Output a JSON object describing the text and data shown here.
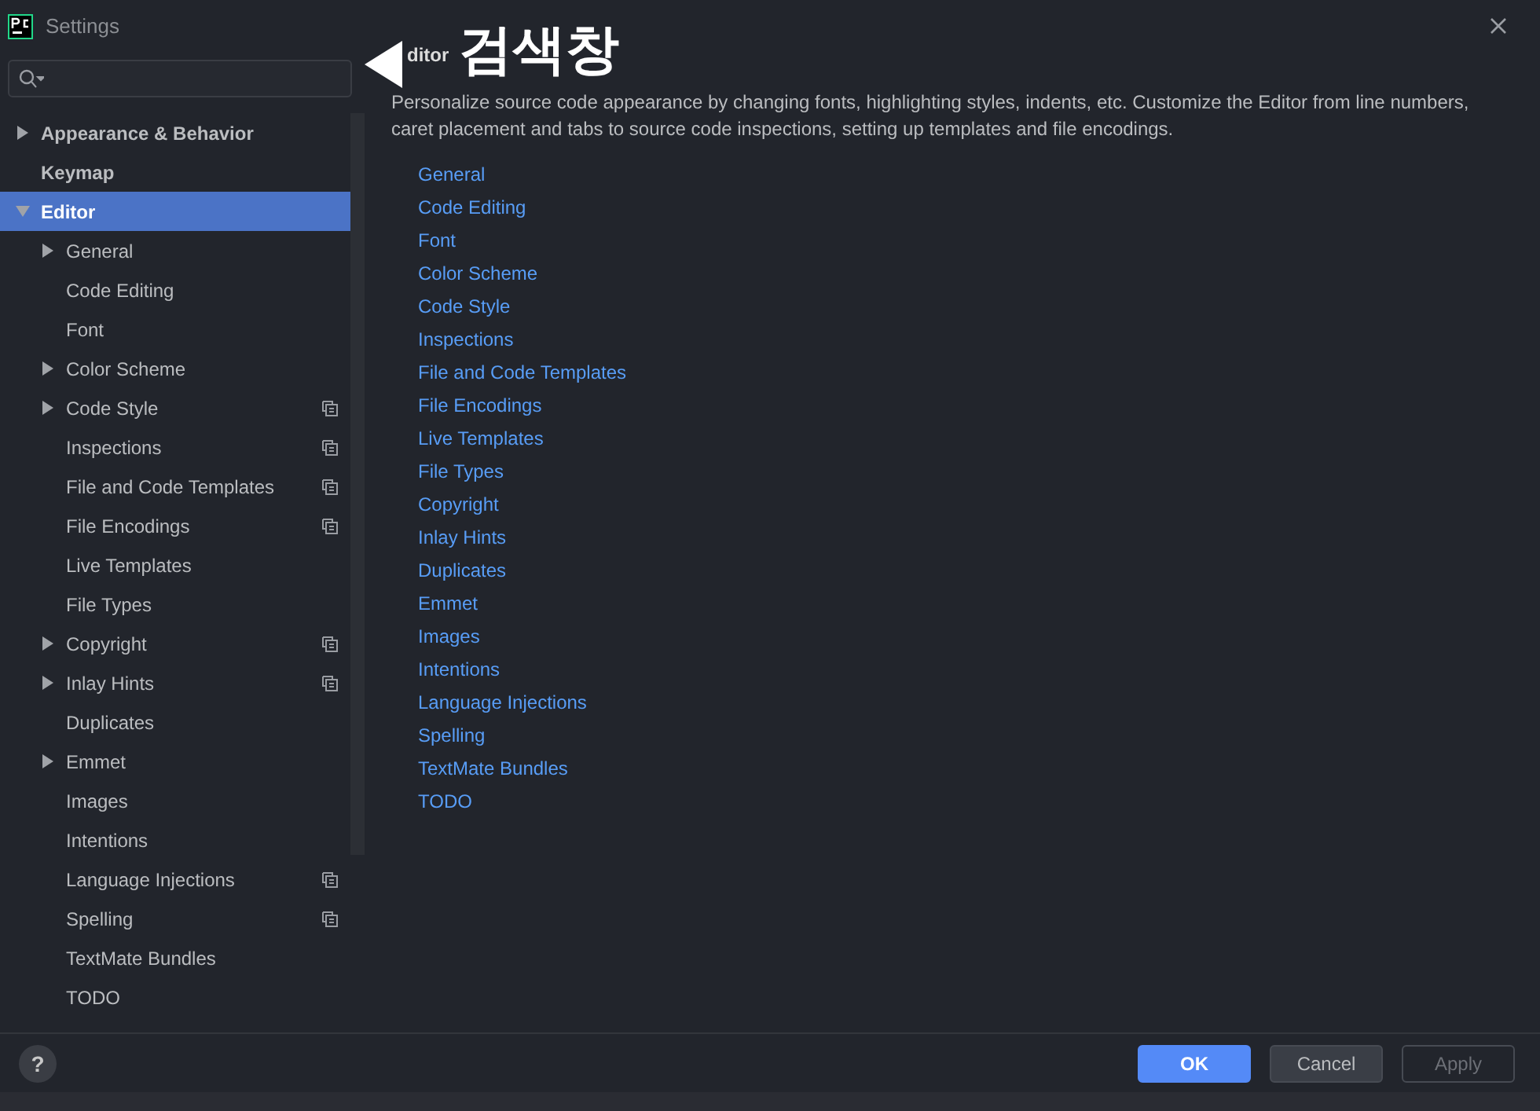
{
  "window": {
    "title": "Settings"
  },
  "annotation": {
    "text": "검색창"
  },
  "tree": [
    {
      "label": "Appearance & Behavior",
      "expandable": true,
      "expanded": false,
      "selected": false,
      "project_level": false
    },
    {
      "label": "Keymap",
      "expandable": false,
      "expanded": false,
      "selected": false,
      "project_level": false
    },
    {
      "label": "Editor",
      "expandable": true,
      "expanded": true,
      "selected": true,
      "project_level": false,
      "children": [
        {
          "label": "General",
          "expandable": true,
          "expanded": false,
          "selected": false,
          "project_level": false
        },
        {
          "label": "Code Editing",
          "expandable": false,
          "expanded": false,
          "selected": false,
          "project_level": false
        },
        {
          "label": "Font",
          "expandable": false,
          "expanded": false,
          "selected": false,
          "project_level": false
        },
        {
          "label": "Color Scheme",
          "expandable": true,
          "expanded": false,
          "selected": false,
          "project_level": false
        },
        {
          "label": "Code Style",
          "expandable": true,
          "expanded": false,
          "selected": false,
          "project_level": true
        },
        {
          "label": "Inspections",
          "expandable": false,
          "expanded": false,
          "selected": false,
          "project_level": true
        },
        {
          "label": "File and Code Templates",
          "expandable": false,
          "expanded": false,
          "selected": false,
          "project_level": true
        },
        {
          "label": "File Encodings",
          "expandable": false,
          "expanded": false,
          "selected": false,
          "project_level": true
        },
        {
          "label": "Live Templates",
          "expandable": false,
          "expanded": false,
          "selected": false,
          "project_level": false
        },
        {
          "label": "File Types",
          "expandable": false,
          "expanded": false,
          "selected": false,
          "project_level": false
        },
        {
          "label": "Copyright",
          "expandable": true,
          "expanded": false,
          "selected": false,
          "project_level": true
        },
        {
          "label": "Inlay Hints",
          "expandable": true,
          "expanded": false,
          "selected": false,
          "project_level": true
        },
        {
          "label": "Duplicates",
          "expandable": false,
          "expanded": false,
          "selected": false,
          "project_level": false
        },
        {
          "label": "Emmet",
          "expandable": true,
          "expanded": false,
          "selected": false,
          "project_level": false
        },
        {
          "label": "Images",
          "expandable": false,
          "expanded": false,
          "selected": false,
          "project_level": false
        },
        {
          "label": "Intentions",
          "expandable": false,
          "expanded": false,
          "selected": false,
          "project_level": false
        },
        {
          "label": "Language Injections",
          "expandable": false,
          "expanded": false,
          "selected": false,
          "project_level": true
        },
        {
          "label": "Spelling",
          "expandable": false,
          "expanded": false,
          "selected": false,
          "project_level": true
        },
        {
          "label": "TextMate Bundles",
          "expandable": false,
          "expanded": false,
          "selected": false,
          "project_level": false
        },
        {
          "label": "TODO",
          "expandable": false,
          "expanded": false,
          "selected": false,
          "project_level": false
        }
      ]
    }
  ],
  "content": {
    "header": "ditor",
    "description": "Personalize source code appearance by changing fonts, highlighting styles, indents, etc. Customize the Editor from line numbers, caret placement and tabs to source code inspections, setting up templates and file encodings.",
    "links": [
      "General",
      "Code Editing",
      "Font",
      "Color Scheme",
      "Code Style",
      "Inspections",
      "File and Code Templates",
      "File Encodings",
      "Live Templates",
      "File Types",
      "Copyright",
      "Inlay Hints",
      "Duplicates",
      "Emmet",
      "Images",
      "Intentions",
      "Language Injections",
      "Spelling",
      "TextMate Bundles",
      "TODO"
    ]
  },
  "footer": {
    "help": "?",
    "buttons": [
      {
        "label": "OK",
        "kind": "primary",
        "disabled": false
      },
      {
        "label": "Cancel",
        "kind": "normal",
        "disabled": false
      },
      {
        "label": "Apply",
        "kind": "normal",
        "disabled": true
      }
    ]
  }
}
